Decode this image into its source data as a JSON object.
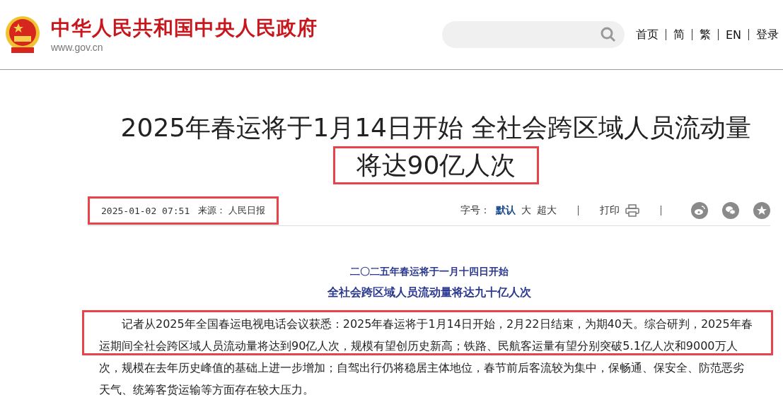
{
  "header": {
    "site_name": "中华人民共和国中央人民政府",
    "site_url": "www.gov.cn",
    "nav": [
      "首页",
      "简",
      "繁",
      "EN",
      "登录"
    ]
  },
  "article": {
    "title_lines": [
      {
        "text": "2025年春运将于1月14日开始 全社会跨区域人员流动量",
        "highlighted": false
      },
      {
        "text": "将达90亿人次",
        "highlighted": true
      }
    ],
    "meta": {
      "date": "2025-01-02 07:51",
      "source_label": "来源：",
      "source": "人民日报",
      "highlighted": true
    },
    "font_size_label": "字号：",
    "font_sizes": [
      {
        "label": "默认",
        "selected": true
      },
      {
        "label": "大",
        "selected": false
      },
      {
        "label": "超大",
        "selected": false
      }
    ],
    "print_label": "打印",
    "subtitles": [
      "二〇二五年春运将于一月十四日开始",
      "全社会跨区域人员流动量将达九十亿人次"
    ],
    "paragraph": {
      "text": "记者从2025年全国春运电视电话会议获悉：2025年春运将于1月14日开始，2月22日结束，为期40天。综合研判，2025年春运期间全社会跨区域人员流动量将达到90亿人次，规模有望创历史新高；铁路、民航客运量有望分别突破5.1亿人次和9000万人次，规模在去年历史峰值的基础上进一步增加；自驾出行仍将稳居主体地位，春节前后客流较为集中，保畅通、保安全、防范恶劣天气、统筹客货运输等方面存在较大压力。",
      "highlighted": true
    }
  }
}
